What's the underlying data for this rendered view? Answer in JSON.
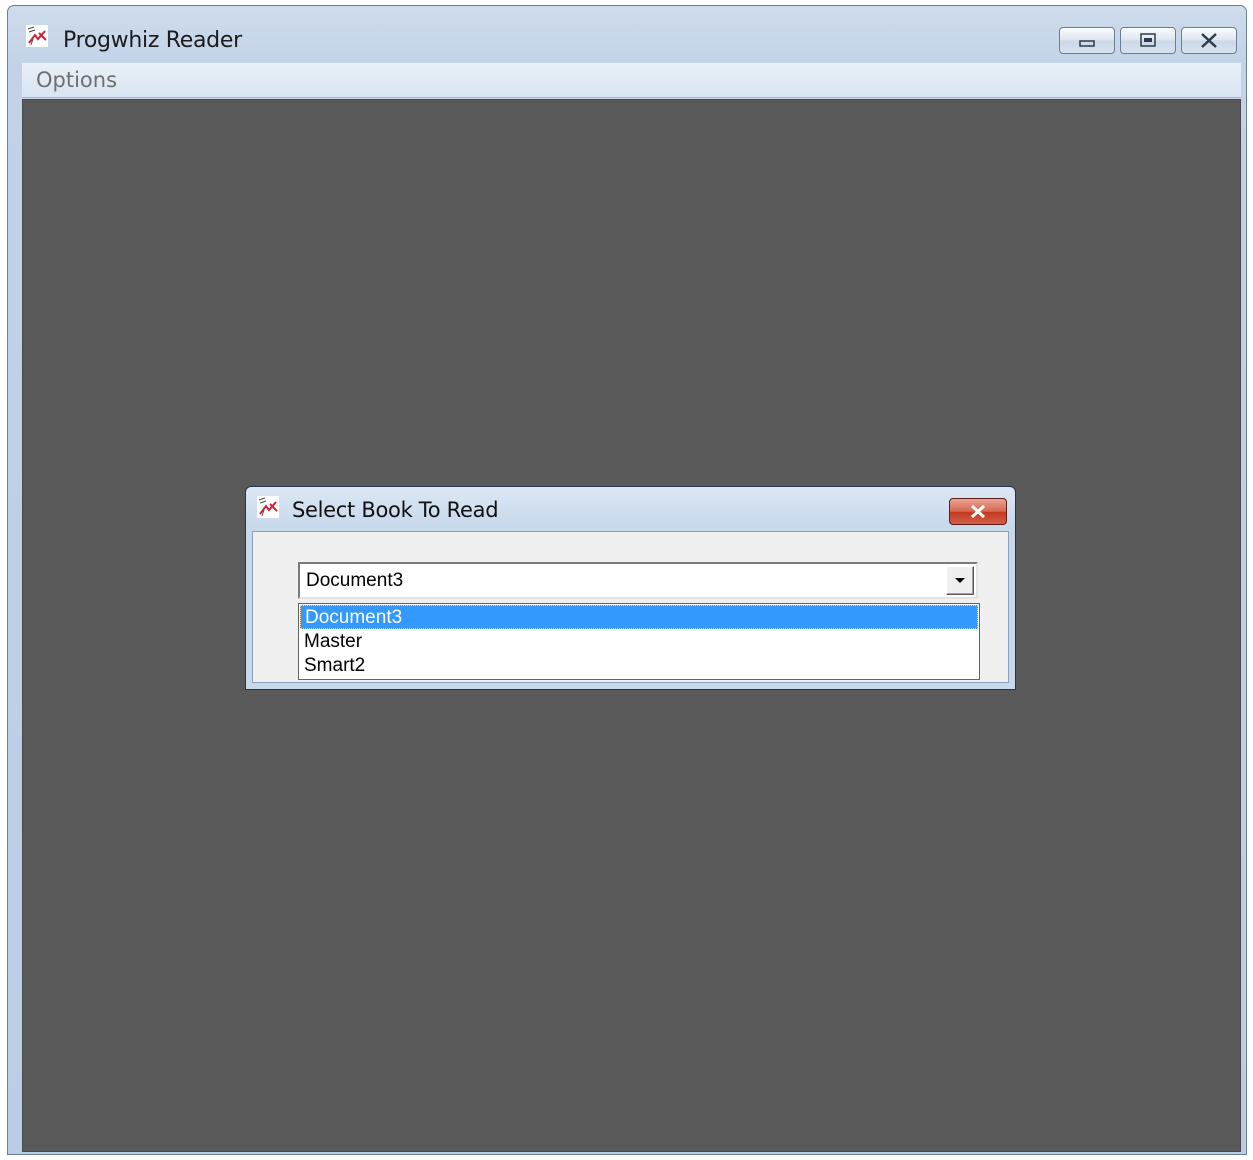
{
  "window": {
    "title": "Progwhiz Reader",
    "icon": "app-pen-icon"
  },
  "menubar": {
    "items": [
      {
        "label": "Options"
      }
    ]
  },
  "dialog": {
    "title": "Select Book To Read",
    "combo": {
      "selected": "Document3",
      "options": [
        {
          "label": "Document3",
          "selected": true
        },
        {
          "label": "Master",
          "selected": false
        },
        {
          "label": "Smart2",
          "selected": false
        }
      ]
    }
  },
  "colors": {
    "client_background": "#595959",
    "selection_highlight": "#3399ff",
    "close_button": "#c3391f"
  }
}
